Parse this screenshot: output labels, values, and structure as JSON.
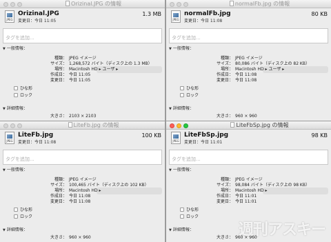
{
  "suffix_info": "の情報",
  "labels": {
    "modified_prefix": "変更日：",
    "general": "一般情報：",
    "details": "詳細情報：",
    "kind": "種類：",
    "size": "サイズ：",
    "where": "場所：",
    "created": "作成日：",
    "modified": "変更日：",
    "stationery": "ひな形",
    "locked": "ロック",
    "dimensions": "大きさ："
  },
  "tag_placeholder": "タグを追加...",
  "icon_ext": "JPEG",
  "windows": [
    {
      "title": "Orizinal.JPG",
      "name": "Orizinal.JPG",
      "size_short": "1.3 MB",
      "modified_short": "今日 11:05",
      "kind": "JPEG イメージ",
      "size_full": "1,268,572 バイト（ディスク上の 1.3 MB）",
      "where": "Macintosh HD ▸ ユーザ ▸",
      "created": "今日 11:05",
      "modified": "今日 11:05",
      "dimensions": "2103 × 2103",
      "active": false
    },
    {
      "title": "normalFb.jpg",
      "name": "normalFb.jpg",
      "size_short": "80 KB",
      "modified_short": "今日 11:08",
      "kind": "JPEG イメージ",
      "size_full": "80,086 バイト（ディスク上の 82 KB）",
      "where": "Macintosh HD ▸ ユーザ ▸",
      "created": "今日 11:08",
      "modified": "今日 11:08",
      "dimensions": "960 × 960",
      "active": false
    },
    {
      "title": "LiteFb.jpg",
      "name": "LiteFb.jpg",
      "size_short": "100 KB",
      "modified_short": "今日 11:08",
      "kind": "JPEG イメージ",
      "size_full": "100,465 バイト（ディスク上の 102 KB）",
      "where": "Macintosh HD ▸",
      "created": "今日 11:08",
      "modified": "今日 11:08",
      "dimensions": "960 × 960",
      "active": false
    },
    {
      "title": "LiteFbSp.jpg",
      "name": "LiteFbSp.jpg",
      "size_short": "98 KB",
      "modified_short": "今日 11:01",
      "kind": "JPEG イメージ",
      "size_full": "98,084 バイト（ディスク上の 98 KB）",
      "where": "Macintosh HD ▸",
      "created": "今日 11:01",
      "modified": "今日 11:01",
      "dimensions": "960 × 960",
      "active": true
    }
  ],
  "watermark": "週刊アスキー"
}
